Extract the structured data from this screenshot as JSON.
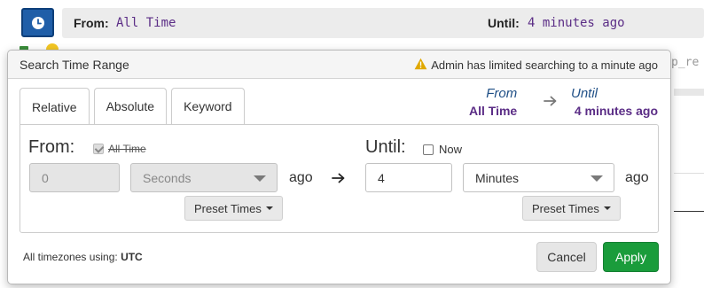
{
  "range_bar": {
    "from_label": "From:",
    "from_value": "All Time",
    "until_label": "Until:",
    "until_value": "4 minutes ago"
  },
  "background": {
    "partial_text": "p_re"
  },
  "popover": {
    "title": "Search Time Range",
    "warning": "Admin has limited searching to a minute ago",
    "tabs": [
      {
        "label": "Relative"
      },
      {
        "label": "Absolute"
      },
      {
        "label": "Keyword"
      }
    ],
    "summary": {
      "from_label": "From",
      "from_value": "All Time",
      "until_label": "Until",
      "until_value": "4 minutes ago"
    },
    "from": {
      "label": "From:",
      "all_time_label": "All Time",
      "all_time_checked": true,
      "amount": "0",
      "unit": "Seconds",
      "ago": "ago",
      "preset": "Preset Times"
    },
    "until": {
      "label": "Until:",
      "now_label": "Now",
      "now_checked": false,
      "amount": "4",
      "unit": "Minutes",
      "ago": "ago",
      "preset": "Preset Times"
    },
    "footer": {
      "tz_prefix": "All timezones using:",
      "tz_value": "UTC",
      "cancel": "Cancel",
      "apply": "Apply"
    }
  },
  "colors": {
    "accent_blue": "#1f5ea8",
    "value_purple": "#5b2d86",
    "apply_green": "#1a9c3b",
    "warning_yellow": "#e0a800"
  },
  "icons": [
    "clock-icon",
    "warning-icon",
    "arrow-right-icon",
    "chevron-down-icon",
    "caret-down-icon"
  ]
}
